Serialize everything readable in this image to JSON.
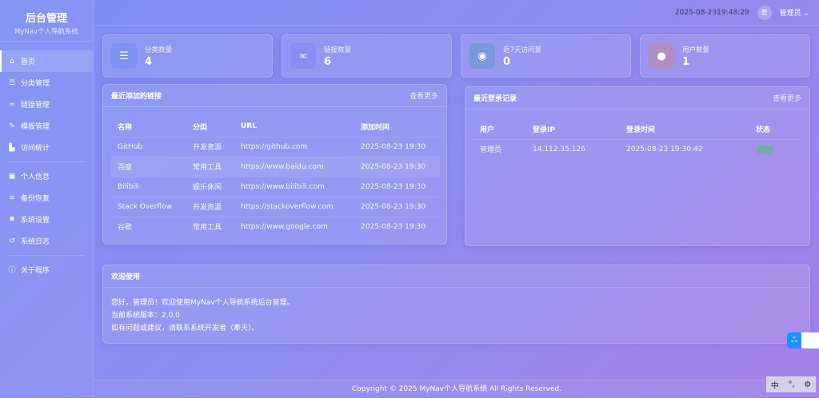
{
  "sidebar": {
    "title": "后台管理",
    "subtitle": "MyNav个人导航系统",
    "items": [
      {
        "label": "首页",
        "icon": "home-icon",
        "glyph": "⌂"
      },
      {
        "label": "分类管理",
        "icon": "list-icon",
        "glyph": "☰"
      },
      {
        "label": "链接管理",
        "icon": "link-icon",
        "glyph": "∞"
      },
      {
        "label": "模板管理",
        "icon": "brush-icon",
        "glyph": "✎"
      },
      {
        "label": "访问统计",
        "icon": "chart-icon",
        "glyph": "▙"
      }
    ],
    "items2": [
      {
        "label": "个人信息",
        "icon": "id-card-icon",
        "glyph": "▣"
      },
      {
        "label": "备份恢复",
        "icon": "database-icon",
        "glyph": "≋"
      },
      {
        "label": "系统设置",
        "icon": "gear-icon",
        "glyph": "✹"
      },
      {
        "label": "系统日志",
        "icon": "history-icon",
        "glyph": "↺"
      }
    ],
    "items3": [
      {
        "label": "关于程序",
        "icon": "info-icon",
        "glyph": "ⓘ"
      }
    ]
  },
  "topbar": {
    "datetime": "2025-08-2319:48:29",
    "avatar": "管",
    "user": "管理员"
  },
  "stats": [
    {
      "label": "分类数量",
      "value": "4",
      "glyph": "☰",
      "color": "#7f92f4"
    },
    {
      "label": "链接数量",
      "value": "6",
      "glyph": "∞",
      "color": "#8a8ef2"
    },
    {
      "label": "近7天访问量",
      "value": "0",
      "glyph": "◉",
      "color": "#7c98d8"
    },
    {
      "label": "用户数量",
      "value": "1",
      "glyph": "●",
      "color": "#b08fc4"
    }
  ],
  "links": {
    "title": "最近添加的链接",
    "more": "查看更多",
    "headers": [
      "名称",
      "分类",
      "URL",
      "添加时间"
    ],
    "rows": [
      [
        "GitHub",
        "开发资源",
        "https://github.com",
        "2025-08-23 19:30"
      ],
      [
        "百度",
        "常用工具",
        "https://www.baidu.com",
        "2025-08-23 19:30"
      ],
      [
        "Bilibili",
        "娱乐休闲",
        "https://www.bilibili.com",
        "2025-08-23 19:30"
      ],
      [
        "Stack Overflow",
        "开发资源",
        "https://stackoverflow.com",
        "2025-08-23 19:30"
      ],
      [
        "谷歌",
        "常用工具",
        "https://www.google.com",
        "2025-08-23 19:30"
      ]
    ]
  },
  "logins": {
    "title": "最近登录记录",
    "more": "查看更多",
    "headers": [
      "用户",
      "登录IP",
      "登录时间",
      "状态"
    ],
    "rows": [
      [
        "管理员",
        "14.112.35.126",
        "2025-08-23 19:30:42",
        "成功"
      ]
    ]
  },
  "welcome": {
    "title": "欢迎使用",
    "lines": [
      "您好，管理员！欢迎使用MyNav个人导航系统后台管理。",
      "当前系统版本：2.0.0",
      "如有问题或建议，请联系系统开发者（奉天）。"
    ]
  },
  "footer": "Copyright © 2025 MyNav个人导航系统 All Rights Reserved.",
  "ime": {
    "mode": "中",
    "punct": "°,",
    "settings": "⚙"
  }
}
